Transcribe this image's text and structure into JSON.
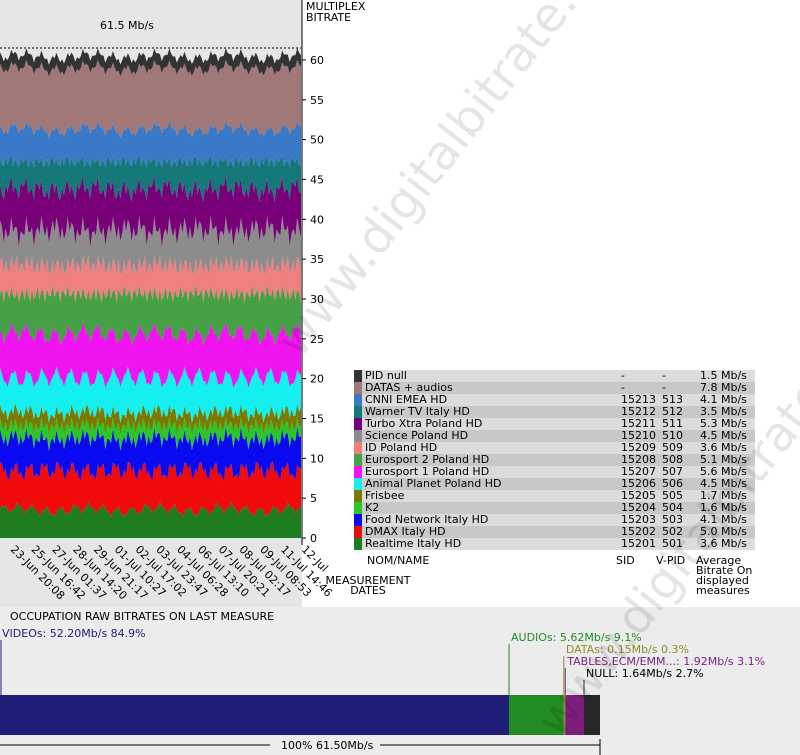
{
  "chart_data": [
    {
      "type": "area",
      "title": "61.5 Mb/s",
      "ylabel": "MULTIPLEX BITRATE",
      "xlabel": "MEASUREMENT DATES",
      "ylim": [
        0,
        62
      ],
      "yticks": [
        "0",
        "5",
        "10",
        "15",
        "20",
        "25",
        "30",
        "35",
        "40",
        "45",
        "50",
        "55",
        "60"
      ],
      "x": [
        "23-Jun 20:08",
        "25-Jun 16:42",
        "27-Jun 01:37",
        "28-Jun 14:20",
        "29-Jun 21:17",
        "01-Jul 10:27",
        "02-Jul 17:02",
        "03-Jul 23:47",
        "04-Jul 06:28",
        "06-Jul 13:10",
        "07-Jul 20:21",
        "08-Jul 02:17",
        "09-Jul 08:53",
        "11-Jul 14:46",
        "12-Jul"
      ],
      "legend_headers": {
        "name": "NOM/NAME",
        "sid": "SID",
        "vpid": "V-PID",
        "avg": "Average Bitrate On displayed measures"
      },
      "series": [
        {
          "name": "PID null",
          "sid": "-",
          "vpid": "-",
          "bitrate": "1.5 Mb/s",
          "value": 1.5,
          "color": "#333333"
        },
        {
          "name": "DATAS + audios",
          "sid": "-",
          "vpid": "-",
          "bitrate": "7.8 Mb/s",
          "value": 7.8,
          "color": "#a07878"
        },
        {
          "name": "CNNI EMEA HD",
          "sid": "15213",
          "vpid": "513",
          "bitrate": "4.1 Mb/s",
          "value": 4.1,
          "color": "#3a78c8"
        },
        {
          "name": "Warner TV Italy HD",
          "sid": "15212",
          "vpid": "512",
          "bitrate": "3.5 Mb/s",
          "value": 3.5,
          "color": "#147878"
        },
        {
          "name": "Turbo Xtra Poland HD",
          "sid": "15211",
          "vpid": "511",
          "bitrate": "5.3 Mb/s",
          "value": 5.3,
          "color": "#780078"
        },
        {
          "name": "Science Poland HD",
          "sid": "15210",
          "vpid": "510",
          "bitrate": "4.5 Mb/s",
          "value": 4.5,
          "color": "#8c8c8c"
        },
        {
          "name": "ID Poland HD",
          "sid": "15209",
          "vpid": "509",
          "bitrate": "3.6 Mb/s",
          "value": 3.6,
          "color": "#f08080"
        },
        {
          "name": "Eurosport 2 Poland HD",
          "sid": "15208",
          "vpid": "508",
          "bitrate": "5.1 Mb/s",
          "value": 5.1,
          "color": "#46a046"
        },
        {
          "name": "Eurosport 1 Poland HD",
          "sid": "15207",
          "vpid": "507",
          "bitrate": "5.6 Mb/s",
          "value": 5.6,
          "color": "#f014f0"
        },
        {
          "name": "Animal Planet Poland HD",
          "sid": "15206",
          "vpid": "506",
          "bitrate": "4.5 Mb/s",
          "value": 4.5,
          "color": "#14f0f0"
        },
        {
          "name": "Frisbee",
          "sid": "15205",
          "vpid": "505",
          "bitrate": "1.7 Mb/s",
          "value": 1.7,
          "color": "#7a7a00"
        },
        {
          "name": "K2",
          "sid": "15204",
          "vpid": "504",
          "bitrate": "1.6 Mb/s",
          "value": 1.6,
          "color": "#28c828"
        },
        {
          "name": "Food Network Italy HD",
          "sid": "15203",
          "vpid": "503",
          "bitrate": "4.1 Mb/s",
          "value": 4.1,
          "color": "#0a0af0"
        },
        {
          "name": "DMAX Italy HD",
          "sid": "15202",
          "vpid": "502",
          "bitrate": "5.0 Mb/s",
          "value": 5.0,
          "color": "#f00a0a"
        },
        {
          "name": "Realtime Italy HD",
          "sid": "15201",
          "vpid": "501",
          "bitrate": "3.6 Mb/s",
          "value": 3.6,
          "color": "#1e7d1e"
        }
      ]
    },
    {
      "type": "bar",
      "title": "OCCUPATION RAW BITRATES ON LAST MEASURE",
      "total_label": "100%  61.50Mb/s",
      "segments": [
        {
          "label": "VIDEOs: 52.20Mb/s  84.9%",
          "value": 52.2,
          "color": "#1e1e78"
        },
        {
          "label": "AUDIOs: 5.62Mb/s  9.1%",
          "value": 5.62,
          "color": "#228b22"
        },
        {
          "label": "DATAs: 0.15Mb/s  0.3%",
          "value": 0.15,
          "color": "#8c8c28"
        },
        {
          "label": "TABLES,ECM/EMM...: 1.92Mb/s  3.1%",
          "value": 1.92,
          "color": "#7d1e7d"
        },
        {
          "label": "NULL: 1.64Mb/s  2.7%",
          "value": 1.64,
          "color": "#282828"
        }
      ]
    }
  ],
  "watermark": "www.digitalbitrate.com"
}
